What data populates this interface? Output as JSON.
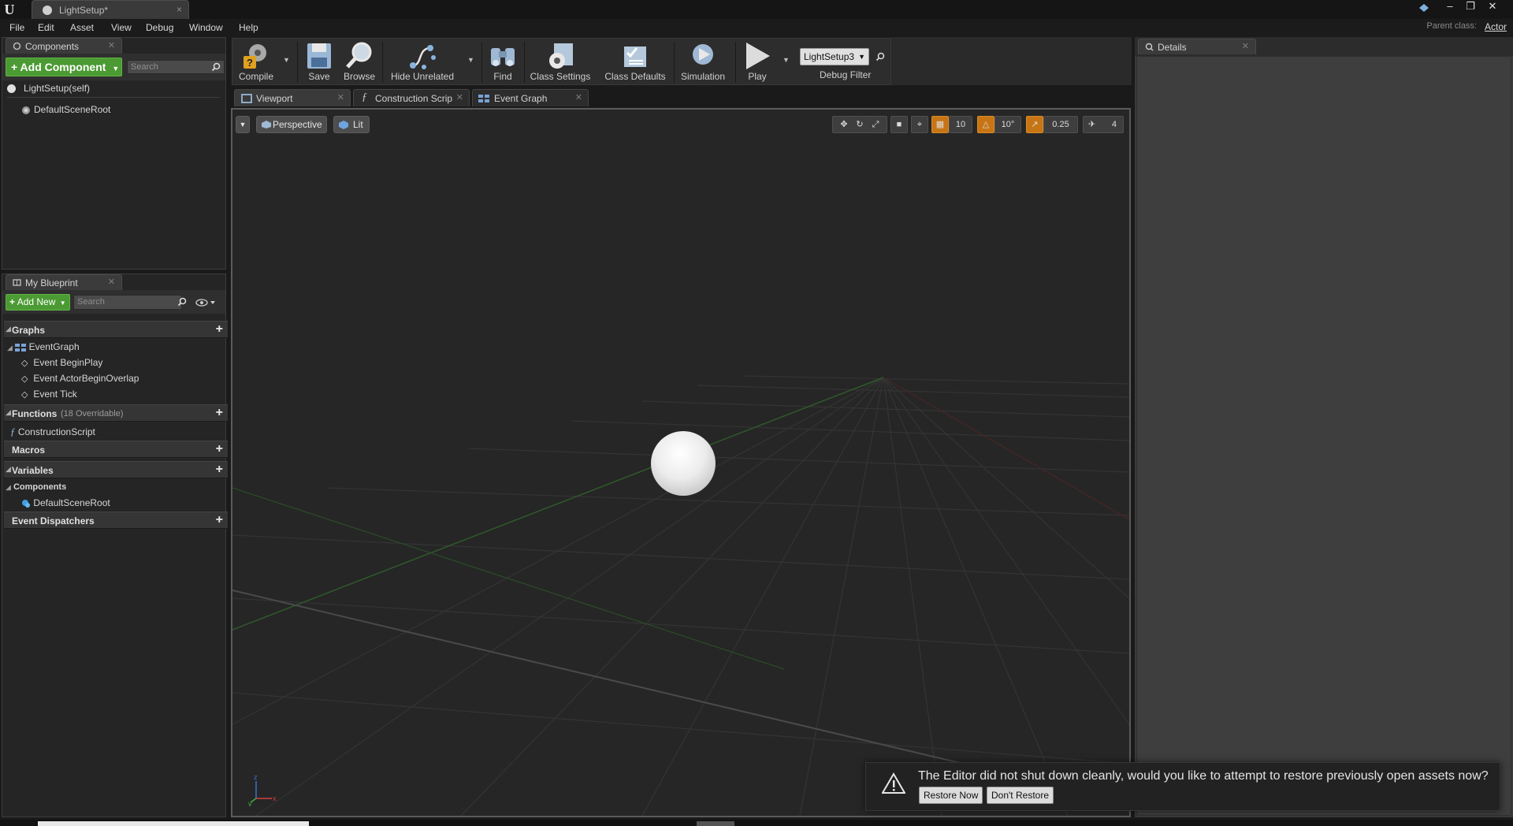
{
  "window": {
    "tab_title": "LightSetup*",
    "close_glyph": "×",
    "controls": [
      "–",
      "❐",
      "✕"
    ]
  },
  "menu": {
    "items": [
      "File",
      "Edit",
      "Asset",
      "View",
      "Debug",
      "Window",
      "Help"
    ],
    "parent_class_label": "Parent class:",
    "parent_class_value": "Actor"
  },
  "components_panel": {
    "tab_label": "Components",
    "add_button": "+ Add Component",
    "search_placeholder": "Search",
    "self_item": "LightSetup(self)",
    "root_item": "DefaultSceneRoot"
  },
  "my_blueprint": {
    "tab_label": "My Blueprint",
    "add_new": "Add New",
    "search_placeholder": "Search",
    "graphs_header": "Graphs",
    "event_graph": "EventGraph",
    "events": [
      "Event BeginPlay",
      "Event ActorBeginOverlap",
      "Event Tick"
    ],
    "functions_header": "Functions",
    "functions_note": "(18 Overridable)",
    "construction_script": "ConstructionScript",
    "macros_header": "Macros",
    "variables_header": "Variables",
    "components_sub": "Components",
    "default_scene_root": "DefaultSceneRoot",
    "dispatchers_header": "Event Dispatchers"
  },
  "toolbar": {
    "compile": "Compile",
    "save": "Save",
    "browse": "Browse",
    "hide_unrelated": "Hide Unrelated",
    "find": "Find",
    "class_settings": "Class Settings",
    "class_defaults": "Class Defaults",
    "simulation": "Simulation",
    "play": "Play",
    "debug_object": "LightSetup3",
    "debug_filter": "Debug Filter"
  },
  "editor_tabs": [
    "Viewport",
    "Construction Scrip",
    "Event Graph"
  ],
  "viewport": {
    "perspective": "Perspective",
    "lit": "Lit",
    "grid_snap": "10",
    "rot_snap": "10°",
    "scale_snap": "0.25",
    "camera_speed": "4"
  },
  "details_panel": {
    "tab_label": "Details"
  },
  "notification": {
    "message": "The Editor did not shut down cleanly, would you like to attempt to restore previously open assets now?",
    "restore_now": "Restore Now",
    "dont_restore": "Don't Restore"
  },
  "colors": {
    "accent_green": "#4b9a33",
    "snap_orange": "#c77514",
    "viewport_bg": "#262626"
  }
}
